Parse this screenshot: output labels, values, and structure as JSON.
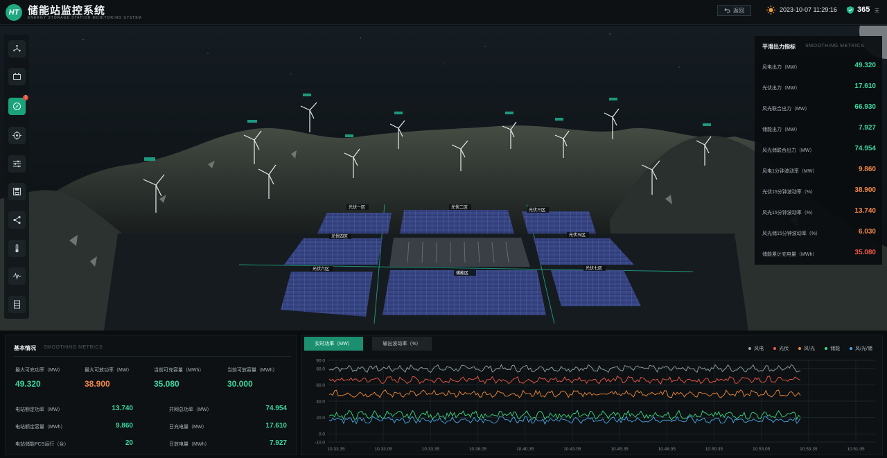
{
  "header": {
    "logo": "HT",
    "title": "储能站监控系统",
    "subtitle": "ENERGY STORAGE STATION MONITORING SYSTEM",
    "back_label": "返回",
    "datetime": "2023-10-07 11:29:16",
    "days_count": "365",
    "days_unit": "天"
  },
  "toolbar": {
    "items": [
      {
        "icon": "fan-icon"
      },
      {
        "icon": "battery-icon"
      },
      {
        "icon": "compass-icon",
        "active": true,
        "badge": "2"
      },
      {
        "icon": "target-icon"
      },
      {
        "icon": "sliders-icon"
      },
      {
        "icon": "save-icon"
      },
      {
        "icon": "share-icon"
      },
      {
        "icon": "thermometer-icon"
      },
      {
        "icon": "waveform-icon"
      },
      {
        "icon": "cabinet-icon"
      }
    ]
  },
  "scene": {
    "labels": [
      "光伏一区",
      "光伏二区",
      "光伏三区",
      "光伏四区",
      "光伏五区",
      "储能区",
      "光伏六区",
      "光伏七区"
    ]
  },
  "smoothing_panel": {
    "title": "平滑出力指标",
    "title_en": "SMOOTHING METRICS",
    "rows": [
      {
        "label": "风电出力（MW）",
        "value": "49.320",
        "color": "green"
      },
      {
        "label": "光伏出力（MW）",
        "value": "17.610",
        "color": "green"
      },
      {
        "label": "风光联合出力（MW）",
        "value": "66.930",
        "color": "green"
      },
      {
        "label": "储能出力（MW）",
        "value": "7.927",
        "color": "green"
      },
      {
        "label": "风光储联合出力（MW）",
        "value": "74.954",
        "color": "green"
      },
      {
        "label": "风电1分钟波动率（MW）",
        "value": "9.860",
        "color": "orange"
      },
      {
        "label": "光伏15分钟波动率（%）",
        "value": "38.900",
        "color": "orange"
      },
      {
        "label": "风光15分钟波动率（%）",
        "value": "13.740",
        "color": "orange"
      },
      {
        "label": "风光储15分钟波动率（%）",
        "value": "6.030",
        "color": "orange"
      },
      {
        "label": "储能累计充电量（MWh）",
        "value": "35.080",
        "color": "red"
      }
    ]
  },
  "basic_panel": {
    "title": "基本情况",
    "title_en": "SMOOTHING METRICS",
    "stats": [
      {
        "label": "最大可充功率（MW）",
        "value": "49.320",
        "color": "green"
      },
      {
        "label": "最大可放功率（MW）",
        "value": "38.900",
        "color": "orange"
      },
      {
        "label": "当前可充容量（MWh）",
        "value": "35.080",
        "color": "green"
      },
      {
        "label": "当前可放容量（MWh）",
        "value": "30.000",
        "color": "green"
      }
    ],
    "left_kv": [
      {
        "label": "电站额定功率（MW）",
        "value": "13.740"
      },
      {
        "label": "电站额定容量（MWh）",
        "value": "9.860"
      },
      {
        "label": "电站储能PCS运行（台）",
        "value": "20"
      }
    ],
    "right_kv": [
      {
        "label": "并网总功率（MW）",
        "value": "74.954"
      },
      {
        "label": "日充电量（MW）",
        "value": "17.610"
      },
      {
        "label": "日放电量（MWh）",
        "value": "7.927"
      }
    ]
  },
  "chart_panel": {
    "tabs": [
      {
        "label": "实时功率（MW）",
        "active": true
      },
      {
        "label": "输出波动率（%）",
        "active": false
      }
    ],
    "legend": [
      {
        "label": "风电",
        "color": "#9aa3a8"
      },
      {
        "label": "光伏",
        "color": "#f25a4a"
      },
      {
        "label": "风/光",
        "color": "#f28a3a"
      },
      {
        "label": "储能",
        "color": "#3ddc84"
      },
      {
        "label": "风/光/储",
        "color": "#4aa8e8"
      }
    ]
  },
  "chart_data": {
    "type": "line",
    "y_ticks": [
      "90.0",
      "80.0",
      "60.0",
      "40.0",
      "20.0",
      "0.0",
      "-10.0"
    ],
    "x_ticks": [
      "10.33.35",
      "10.33.05",
      "10.33.35",
      "10.38.05",
      "10.40.35",
      "10.43.05",
      "10.45.35",
      "10.48.05",
      "10.50.35",
      "10.53.05",
      "10.53.35",
      "10.51.05"
    ],
    "ylim": [
      -10,
      90
    ],
    "grid": true,
    "series": [
      {
        "name": "风电",
        "color": "#9aa3a8",
        "mean": 80,
        "amp": 5
      },
      {
        "name": "光伏",
        "color": "#f25a4a",
        "mean": 66,
        "amp": 5
      },
      {
        "name": "风/光",
        "color": "#f28a3a",
        "mean": 49,
        "amp": 5
      },
      {
        "name": "储能",
        "color": "#3ddc84",
        "mean": 23,
        "amp": 6
      },
      {
        "name": "风/光/储",
        "color": "#4aa8e8",
        "mean": 17,
        "amp": 5
      }
    ]
  }
}
